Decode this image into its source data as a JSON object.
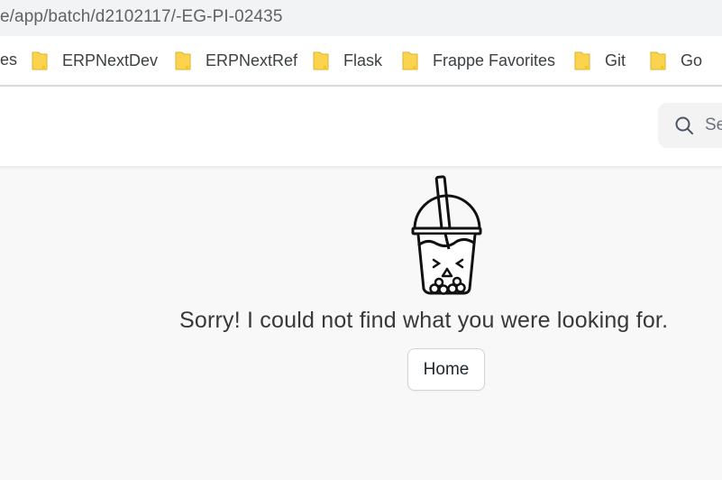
{
  "browser": {
    "url": "e/app/batch/d2102117/-EG-PI-02435",
    "bookmarks": [
      {
        "label": "es",
        "icon": "folder-icon"
      },
      {
        "label": "ERPNextDev",
        "icon": "folder-icon"
      },
      {
        "label": "ERPNextRef",
        "icon": "folder-icon"
      },
      {
        "label": "Flask",
        "icon": "folder-icon"
      },
      {
        "label": "Frappe Favorites",
        "icon": "folder-icon"
      },
      {
        "label": "Git",
        "icon": "folder-icon"
      },
      {
        "label": "Go",
        "icon": "folder-icon"
      }
    ]
  },
  "navbar": {
    "search_text": "Se",
    "search_icon": "search-icon"
  },
  "main": {
    "illustration": "bubble-tea-cup-icon",
    "message": "Sorry! I could not find what you were looking for.",
    "home_label": "Home"
  },
  "colors": {
    "folder": "#fcd34d",
    "page_background": "#f8f8f8"
  }
}
